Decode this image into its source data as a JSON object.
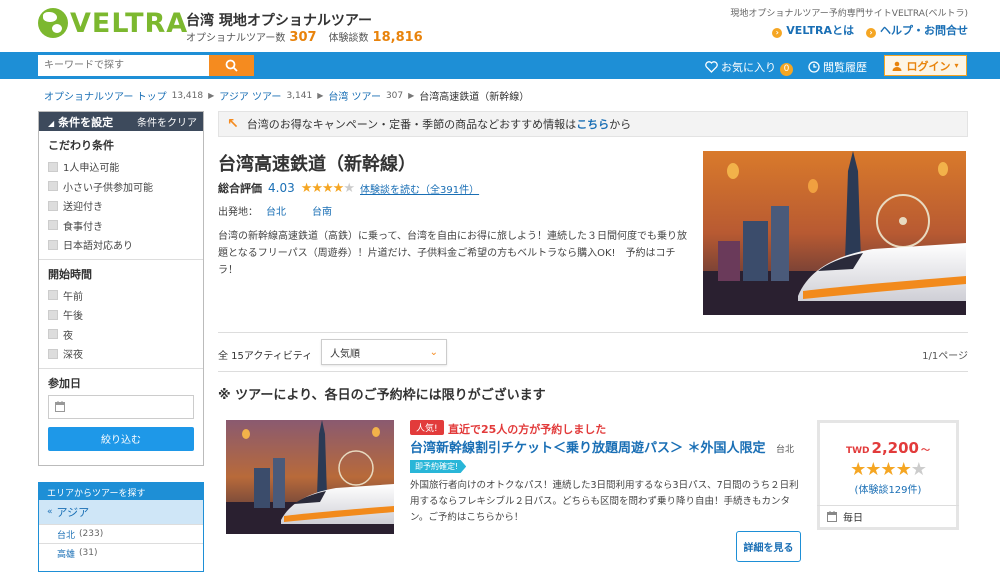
{
  "header": {
    "logo_text": "VELTRA",
    "site_title": "台湾 現地オプショナルツアー",
    "tour_count_label": "オプショナルツアー数",
    "tour_count": "307",
    "review_count_label": "体験談数",
    "review_count": "18,816",
    "tagline": "現地オプショナルツアー予約専門サイトVELTRA(ベルトラ)",
    "about_link": "VELTRAとは",
    "help_link": "ヘルプ・お問合せ"
  },
  "navbar": {
    "search_placeholder": "キーワードで探す",
    "favorites_label": "お気に入り",
    "favorites_count": "0",
    "history_label": "閲覧履歴",
    "login_label": "ログイン"
  },
  "breadcrumb": [
    {
      "label": "オプショナルツアー トップ",
      "count": "13,418"
    },
    {
      "label": "アジア ツアー",
      "count": "3,141"
    },
    {
      "label": "台湾 ツアー",
      "count": "307"
    },
    {
      "label": "台湾高速鉄道（新幹線）",
      "count": ""
    }
  ],
  "filters": {
    "title": "条件を設定",
    "clear": "条件をクリア",
    "conditions_title": "こだわり条件",
    "conditions": [
      "1人申込可能",
      "小さい子供参加可能",
      "送迎付き",
      "食事付き",
      "日本語対応あり"
    ],
    "time_title": "開始時間",
    "times": [
      "午前",
      "午後",
      "夜",
      "深夜"
    ],
    "date_title": "参加日",
    "submit": "絞り込む"
  },
  "area": {
    "title": "エリアからツアーを探す",
    "selected": "アジア",
    "items": [
      {
        "name": "台北",
        "count": "(233)"
      },
      {
        "name": "高雄",
        "count": "(31)"
      }
    ]
  },
  "promo": {
    "text_before": "台湾のお得なキャンペーン・定番・季節の商品などおすすめ情報は",
    "link": "こちら",
    "text_after": "から"
  },
  "product": {
    "title": "台湾高速鉄道（新幹線）",
    "rating_label": "総合評価",
    "rating": "4.03",
    "rating_value": 4.03,
    "reviews_link": "体験談を読む（全391件）",
    "departure_label": "出発地：",
    "departures": [
      "台北",
      "台南"
    ],
    "description": "台湾の新幹線高速鉄道（高鉄）に乗って、台湾を自由にお得に旅しよう！連続した３日間何度でも乗り放題となるフリーパス（周遊券）！片道だけ、子供料金ご希望の方もベルトラなら購入OK!　予約はコチラ！"
  },
  "listing": {
    "count_text": "全 15アクティビティ",
    "sort_selected": "人気順",
    "page_info": "1/1ページ",
    "notice": "※ ツアーにより、各日のご予約枠には限りがございます"
  },
  "tour": {
    "hot_badge": "人気!",
    "hot_text": "直近で25人の方が予約しました",
    "title": "台湾新幹線割引チケット＜乗り放題周遊パス＞ ＊外国人限定",
    "location": "台北",
    "instant_badge": "即予約確定!",
    "description": "外国旅行者向けのオトクなパス！連続した3日間利用するなら3日パス、7日間のうち２日利用するならフレキシブル２日パス。どちらも区間を問わず乗り降り自由！手続きもカンタン。ご予約はこちらから！",
    "price_currency": "TWD",
    "price": "2,200",
    "price_suffix": "～",
    "stars_value": 4,
    "reviews": "(体験談129件)",
    "schedule": "毎日",
    "detail_button": "詳細を見る"
  },
  "colors": {
    "brand_green": "#7cb82f",
    "nav_blue": "#1e8fd6",
    "accent_orange": "#f58b1f",
    "price_red": "#e23b3b"
  }
}
